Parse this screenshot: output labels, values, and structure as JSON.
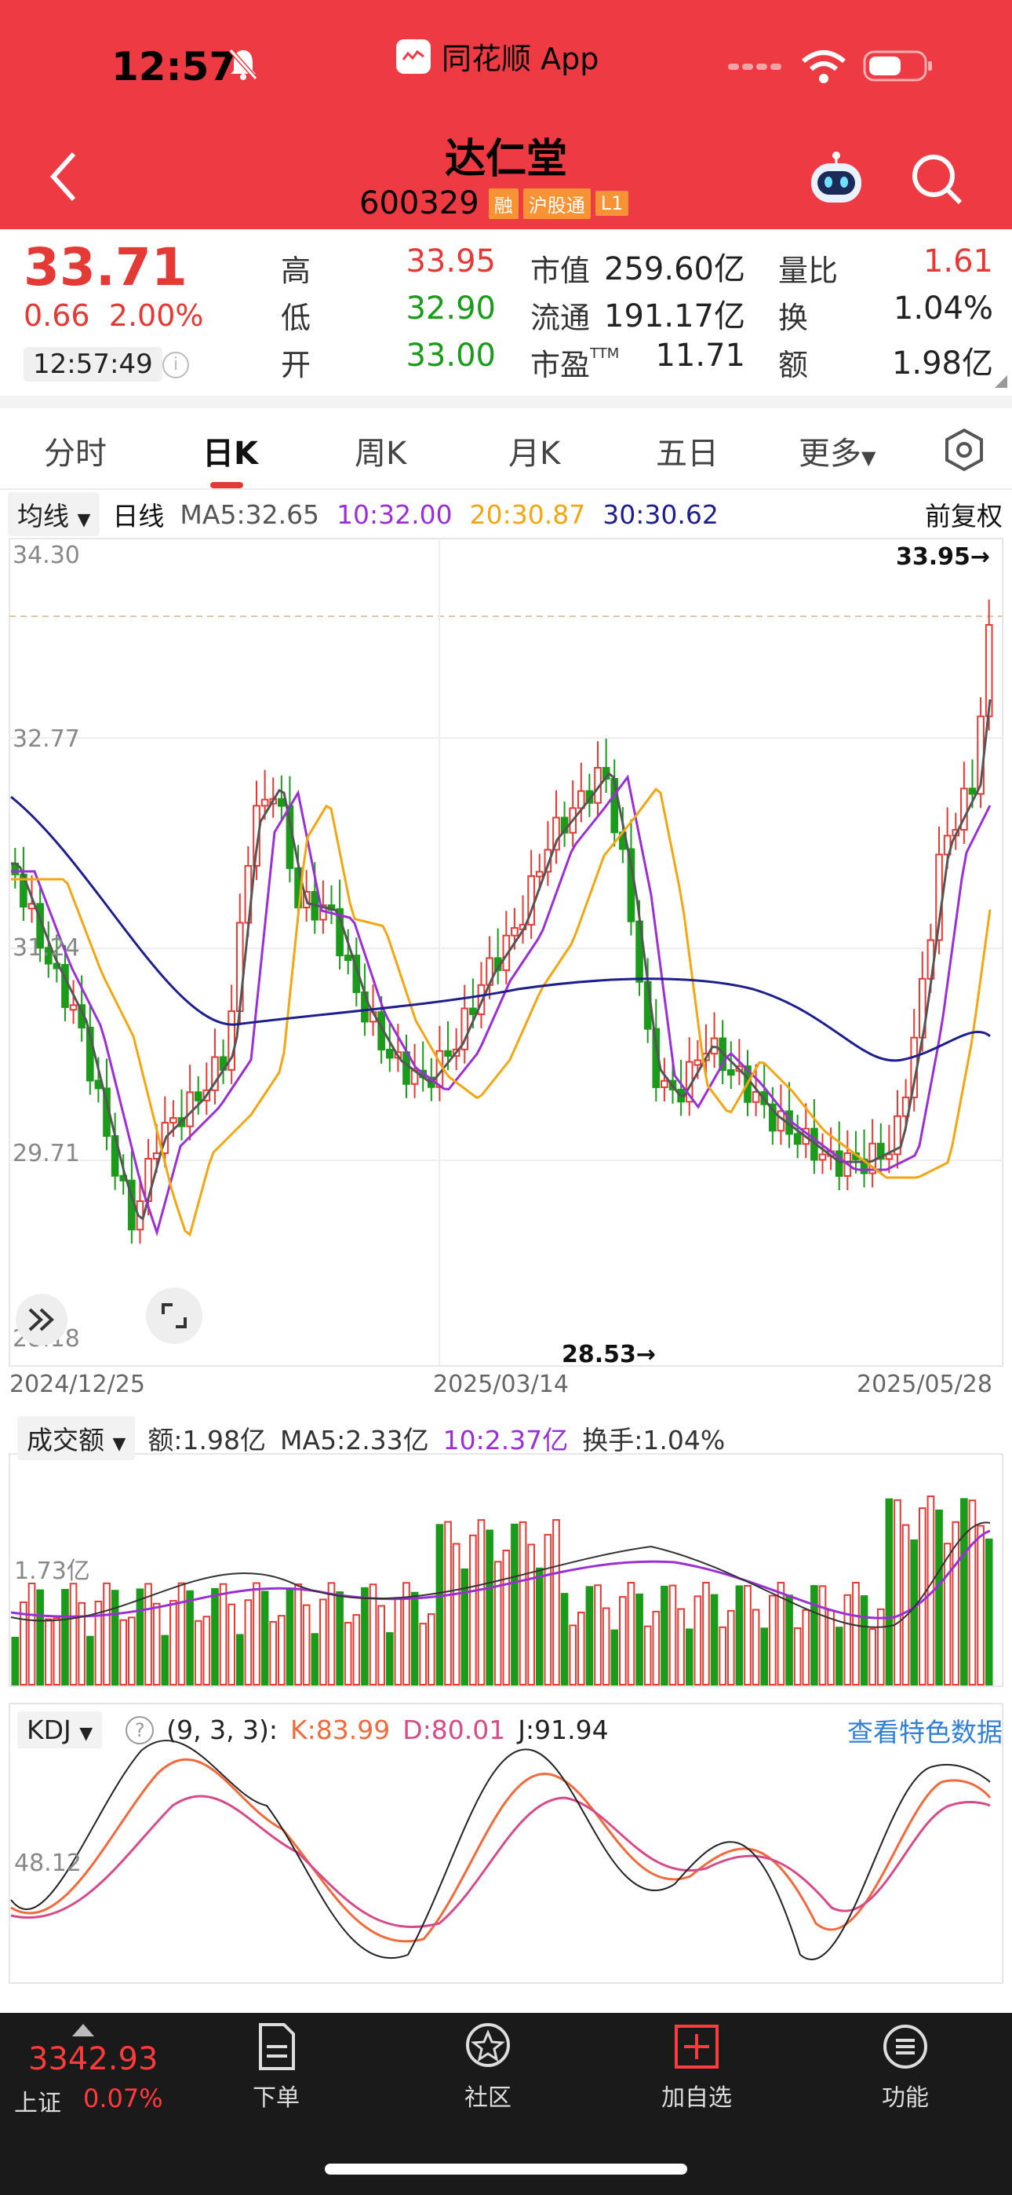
{
  "status": {
    "time": "12:57",
    "app": "同花顺 App"
  },
  "stock": {
    "name": "达仁堂",
    "code": "600329",
    "badges": [
      "融",
      "沪股通",
      "L1"
    ]
  },
  "quote": {
    "price": "33.71",
    "change": "0.66",
    "change_pct": "2.00%",
    "time": "12:57:49",
    "high_label": "高",
    "high": "33.95",
    "low_label": "低",
    "low": "32.90",
    "open_label": "开",
    "open": "33.00",
    "mcap_label": "市值",
    "mcap": "259.60亿",
    "float_label": "流通",
    "float": "191.17亿",
    "pe_label": "市盈",
    "pe_sup": "TTM",
    "pe": "11.71",
    "vr_label": "量比",
    "vr": "1.61",
    "turn_label": "换",
    "turn": "1.04%",
    "amt_label": "额",
    "amt": "1.98亿"
  },
  "tabs": [
    "分时",
    "日K",
    "周K",
    "月K",
    "五日",
    "更多"
  ],
  "ma_row": {
    "selector": "均线",
    "period": "日线",
    "ma5": "MA5:32.65",
    "ma10": "10:32.00",
    "ma20": "20:30.87",
    "ma30": "30:30.62",
    "adjust": "前复权"
  },
  "chart": {
    "y_ticks": [
      "34.30",
      "32.77",
      "31.24",
      "29.71",
      "28.18"
    ],
    "max_label": "33.95→",
    "min_label": "28.53→",
    "dates": [
      "2024/12/25",
      "2025/03/14",
      "2025/05/28"
    ]
  },
  "volume_row": {
    "selector": "成交额",
    "amount": "额:1.98亿",
    "ma5": "MA5:2.33亿",
    "ma10": "10:2.37亿",
    "turnover": "换手:1.04%",
    "y_tick": "1.73亿"
  },
  "kdj_row": {
    "selector": "KDJ",
    "params": "(9, 3, 3):",
    "k": "K:83.99",
    "d": "D:80.01",
    "j": "J:91.94",
    "link": "查看特色数据",
    "y_tick": "48.12"
  },
  "bottom": {
    "index_price": "3342.93",
    "index_name": "上证",
    "index_pct": "0.07%",
    "nav": [
      "下单",
      "社区",
      "加自选",
      "功能"
    ]
  },
  "colors": {
    "red": "#e43a35",
    "green": "#1a9b1a",
    "ma5": "#555555",
    "ma10": "#9b2fd6",
    "ma20": "#f2a612",
    "ma30": "#1e1f8c"
  }
}
